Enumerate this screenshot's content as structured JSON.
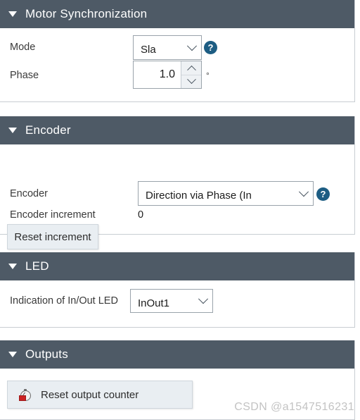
{
  "sections": [
    {
      "id": "motor-synchronization",
      "title": "Motor Synchronization",
      "caret": "caret-down-icon",
      "rows": [
        {
          "label": "Mode",
          "control": "dropdown",
          "value": "Sla",
          "help": "?"
        },
        {
          "label": "Phase",
          "control": "spinner",
          "value": "1.0",
          "unit": "°"
        }
      ]
    },
    {
      "id": "encoder",
      "title": "Encoder",
      "caret": "caret-down-icon",
      "rows": [
        {
          "label": "Encoder",
          "control": "dropdown",
          "value": "Direction via Phase (In",
          "help": "?"
        },
        {
          "label": "Encoder increment",
          "control": "static",
          "value": "0"
        }
      ],
      "button": {
        "label": "Reset increment"
      }
    },
    {
      "id": "led",
      "title": "LED",
      "caret": "caret-down-icon",
      "rows": [
        {
          "label": "Indication of In/Out LED",
          "control": "dropdown",
          "value": "InOut1"
        }
      ]
    },
    {
      "id": "outputs",
      "title": "Outputs",
      "caret": "caret-down-icon",
      "button": {
        "label": "Reset output counter",
        "icon": "counter-reset-icon"
      }
    }
  ],
  "watermark": "CSDN @a1547516231",
  "colors": {
    "header_bg": "#4e5a66",
    "header_text": "#ffffff",
    "help_icon": "#1d5d83",
    "button_bg": "#e9eef2",
    "panel_border": "#c8cdd2",
    "icon_accent_red": "#cc2222"
  }
}
